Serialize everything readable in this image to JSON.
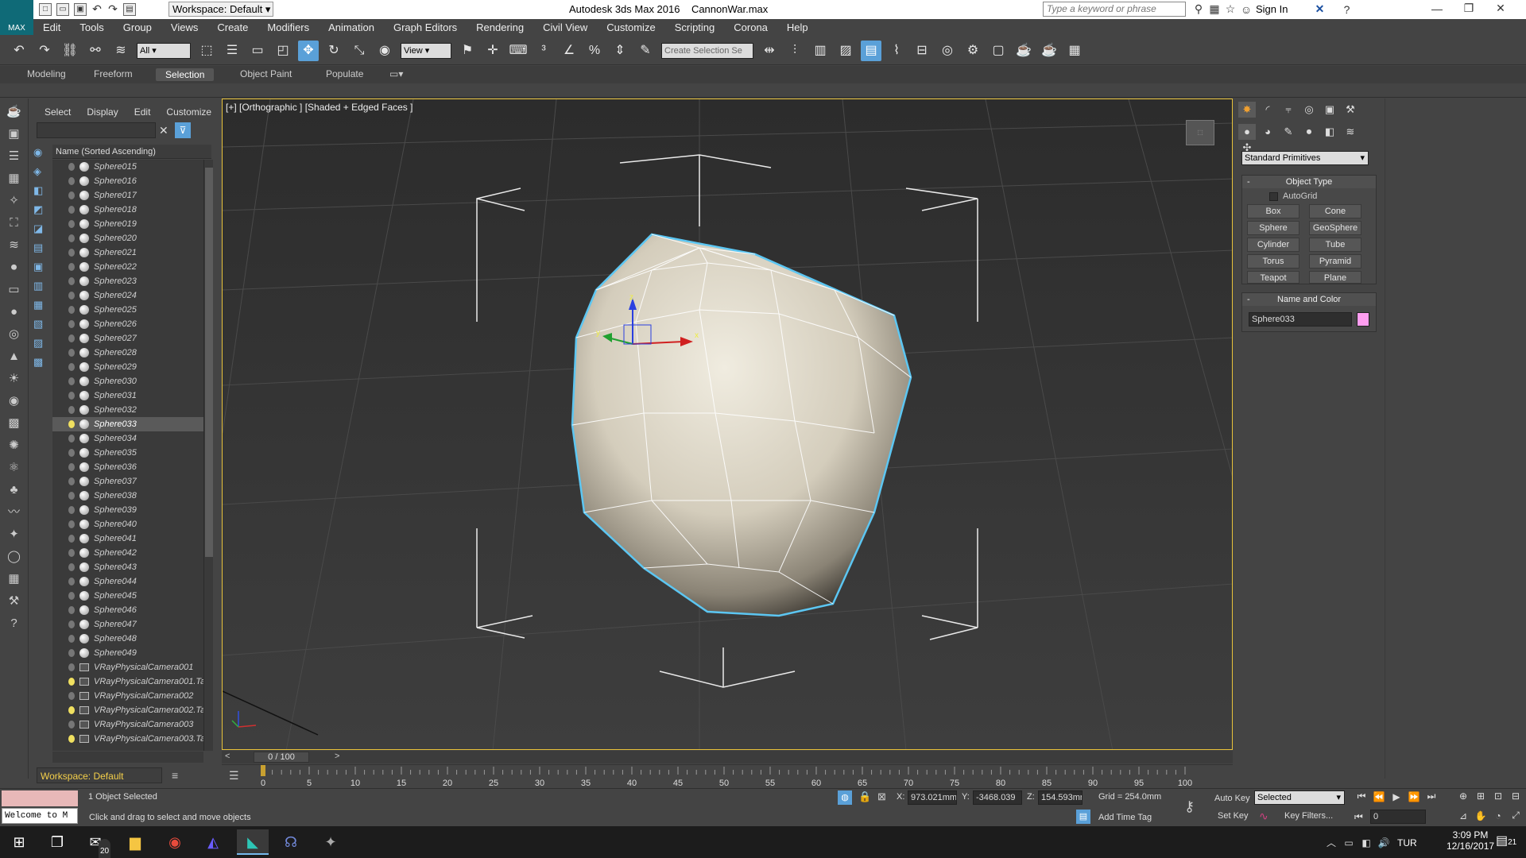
{
  "app": {
    "title": "Autodesk 3ds Max 2016",
    "file": "CannonWar.max",
    "workspace": "Workspace: Default",
    "search_placeholder": "Type a keyword or phrase",
    "sign_in": "Sign In",
    "logo_text": "MAX"
  },
  "menu": [
    "Edit",
    "Tools",
    "Group",
    "Views",
    "Create",
    "Modifiers",
    "Animation",
    "Graph Editors",
    "Rendering",
    "Civil View",
    "Customize",
    "Scripting",
    "Corona",
    "Help"
  ],
  "toolbar": {
    "filter": "All",
    "coord": "View",
    "selection_set_placeholder": "Create Selection Se"
  },
  "ribbon": {
    "tabs": [
      "Modeling",
      "Freeform",
      "Selection",
      "Object Paint",
      "Populate"
    ],
    "active": "Selection"
  },
  "explorer": {
    "menu": [
      "Select",
      "Display",
      "Edit",
      "Customize"
    ],
    "header": "Name (Sorted Ascending)",
    "items": [
      {
        "name": "Sphere015",
        "kind": "sphere",
        "light": false
      },
      {
        "name": "Sphere016",
        "kind": "sphere",
        "light": false
      },
      {
        "name": "Sphere017",
        "kind": "sphere",
        "light": false
      },
      {
        "name": "Sphere018",
        "kind": "sphere",
        "light": false
      },
      {
        "name": "Sphere019",
        "kind": "sphere",
        "light": false
      },
      {
        "name": "Sphere020",
        "kind": "sphere",
        "light": false
      },
      {
        "name": "Sphere021",
        "kind": "sphere",
        "light": false
      },
      {
        "name": "Sphere022",
        "kind": "sphere",
        "light": false
      },
      {
        "name": "Sphere023",
        "kind": "sphere",
        "light": false
      },
      {
        "name": "Sphere024",
        "kind": "sphere",
        "light": false
      },
      {
        "name": "Sphere025",
        "kind": "sphere",
        "light": false
      },
      {
        "name": "Sphere026",
        "kind": "sphere",
        "light": false
      },
      {
        "name": "Sphere027",
        "kind": "sphere",
        "light": false
      },
      {
        "name": "Sphere028",
        "kind": "sphere",
        "light": false
      },
      {
        "name": "Sphere029",
        "kind": "sphere",
        "light": false
      },
      {
        "name": "Sphere030",
        "kind": "sphere",
        "light": false
      },
      {
        "name": "Sphere031",
        "kind": "sphere",
        "light": false
      },
      {
        "name": "Sphere032",
        "kind": "sphere",
        "light": false
      },
      {
        "name": "Sphere033",
        "kind": "sphere",
        "light": true,
        "selected": true
      },
      {
        "name": "Sphere034",
        "kind": "sphere",
        "light": false
      },
      {
        "name": "Sphere035",
        "kind": "sphere",
        "light": false
      },
      {
        "name": "Sphere036",
        "kind": "sphere",
        "light": false
      },
      {
        "name": "Sphere037",
        "kind": "sphere",
        "light": false
      },
      {
        "name": "Sphere038",
        "kind": "sphere",
        "light": false
      },
      {
        "name": "Sphere039",
        "kind": "sphere",
        "light": false
      },
      {
        "name": "Sphere040",
        "kind": "sphere",
        "light": false
      },
      {
        "name": "Sphere041",
        "kind": "sphere",
        "light": false
      },
      {
        "name": "Sphere042",
        "kind": "sphere",
        "light": false
      },
      {
        "name": "Sphere043",
        "kind": "sphere",
        "light": false
      },
      {
        "name": "Sphere044",
        "kind": "sphere",
        "light": false
      },
      {
        "name": "Sphere045",
        "kind": "sphere",
        "light": false
      },
      {
        "name": "Sphere046",
        "kind": "sphere",
        "light": false
      },
      {
        "name": "Sphere047",
        "kind": "sphere",
        "light": false
      },
      {
        "name": "Sphere048",
        "kind": "sphere",
        "light": false
      },
      {
        "name": "Sphere049",
        "kind": "sphere",
        "light": false
      },
      {
        "name": "VRayPhysicalCamera001",
        "kind": "camera",
        "light": false
      },
      {
        "name": "VRayPhysicalCamera001.Ta",
        "kind": "camera",
        "light": true
      },
      {
        "name": "VRayPhysicalCamera002",
        "kind": "camera",
        "light": false
      },
      {
        "name": "VRayPhysicalCamera002.Ta",
        "kind": "camera",
        "light": true
      },
      {
        "name": "VRayPhysicalCamera003",
        "kind": "camera",
        "light": false
      },
      {
        "name": "VRayPhysicalCamera003.Ta",
        "kind": "camera",
        "light": true
      }
    ],
    "workspace_label": "Workspace: Default"
  },
  "viewport": {
    "label": "[+] [Orthographic ] [Shaded + Edged Faces ]",
    "accent": "#e8c23a",
    "gizmo_x": "x",
    "gizmo_y": "y",
    "gizmo_z": "z"
  },
  "command_panel": {
    "category": "Standard Primitives",
    "object_type_title": "Object Type",
    "autogrid": "AutoGrid",
    "buttons": [
      "Box",
      "Cone",
      "Sphere",
      "GeoSphere",
      "Cylinder",
      "Tube",
      "Torus",
      "Pyramid",
      "Teapot",
      "Plane"
    ],
    "name_color_title": "Name and Color",
    "object_name": "Sphere033",
    "object_color": "#ff9ef0"
  },
  "timeline": {
    "frame": "0 / 100",
    "ticks": [
      "0",
      "5",
      "10",
      "15",
      "20",
      "25",
      "30",
      "35",
      "40",
      "45",
      "50",
      "55",
      "60",
      "65",
      "70",
      "75",
      "80",
      "85",
      "90",
      "95",
      "100"
    ]
  },
  "status": {
    "maxscript": "Welcome to M",
    "selected": "1 Object Selected",
    "prompt": "Click and drag to select and move objects",
    "x_label": "X:",
    "x": "973.021mm",
    "y_label": "Y:",
    "y": "-3468.039",
    "z_label": "Z:",
    "z": "154.593mm",
    "grid": "Grid = 254.0mm",
    "add_time_tag": "Add Time Tag",
    "auto_key": "Auto Key",
    "auto_key_mode": "Selected",
    "set_key": "Set Key",
    "key_filters": "Key Filters...",
    "frame_field": "0"
  },
  "taskbar": {
    "lang": "TUR",
    "time": "3:09 PM",
    "date": "12/16/2017",
    "mail_badge": "20",
    "notif_badge": "21"
  }
}
